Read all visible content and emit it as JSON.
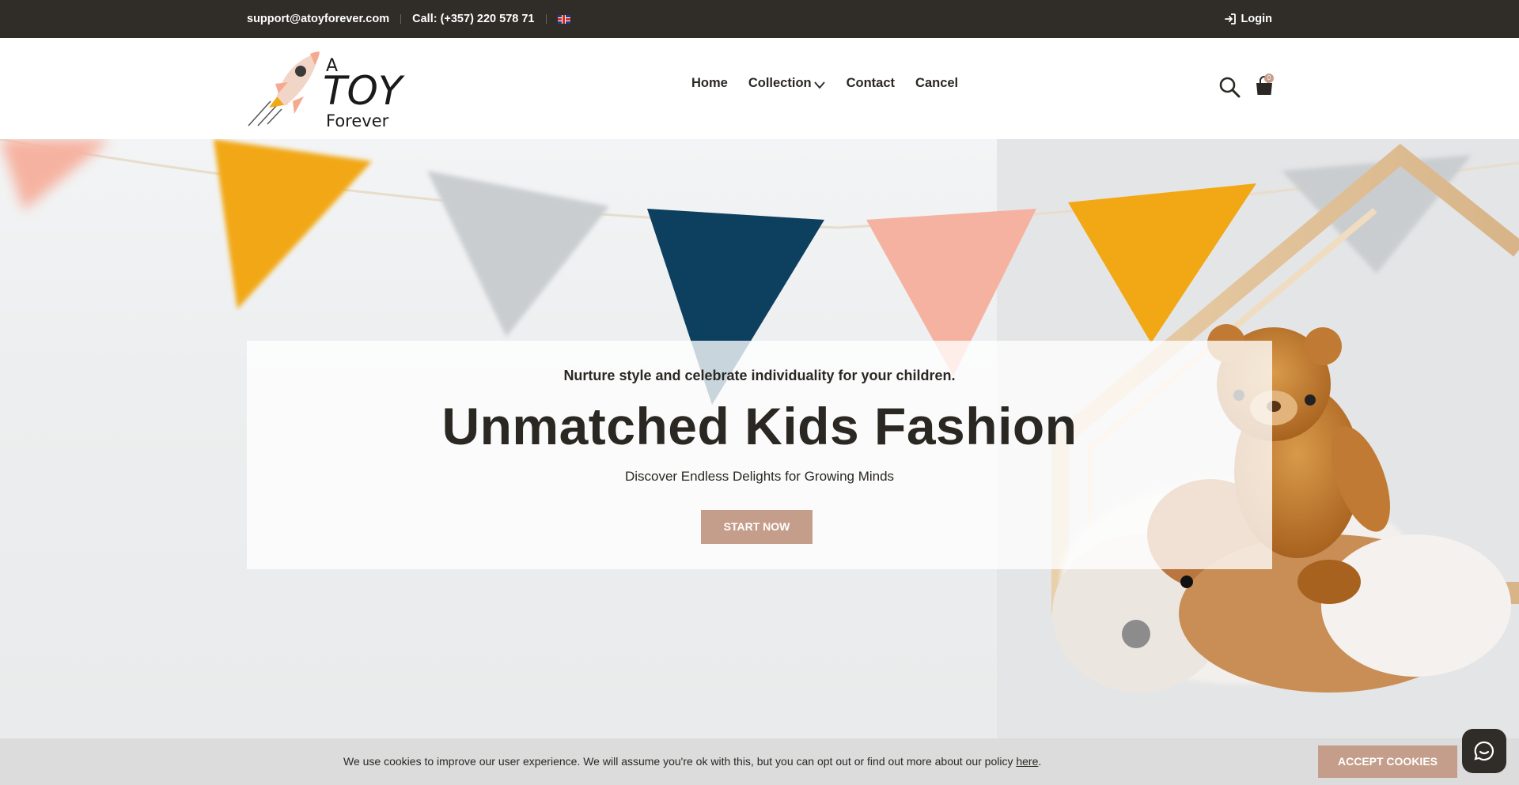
{
  "topbar": {
    "email": "support@atoyforever.com",
    "phone": "Call: (+357) 220 578 71",
    "language_icon": "uk-flag-icon",
    "login_label": "Login"
  },
  "logo": {
    "line1": "A",
    "line2": "TOY",
    "line3": "Forever"
  },
  "nav": {
    "items": [
      {
        "label": "Home"
      },
      {
        "label": "Collection"
      },
      {
        "label": "Contact"
      },
      {
        "label": "Cancel"
      }
    ]
  },
  "cart": {
    "count": "0"
  },
  "hero": {
    "subtitle": "Nurture style and celebrate individuality for your children.",
    "title": "Unmatched Kids Fashion",
    "description": "Discover Endless Delights for Growing Minds",
    "button_label": "START NOW"
  },
  "cookie": {
    "text": "We use cookies to improve our user experience. We will assume you're ok with this, but you can opt out or find out more about our policy ",
    "link_label": "here",
    "suffix": ".",
    "accept_label": "ACCEPT COOKIES"
  },
  "colors": {
    "dark": "#302c27",
    "accent": "#c49e8a",
    "pennant_yellow": "#f2a814",
    "pennant_navy": "#0d3f5f",
    "pennant_pink": "#f6b2a0",
    "pennant_grey": "#c9cdd0"
  }
}
